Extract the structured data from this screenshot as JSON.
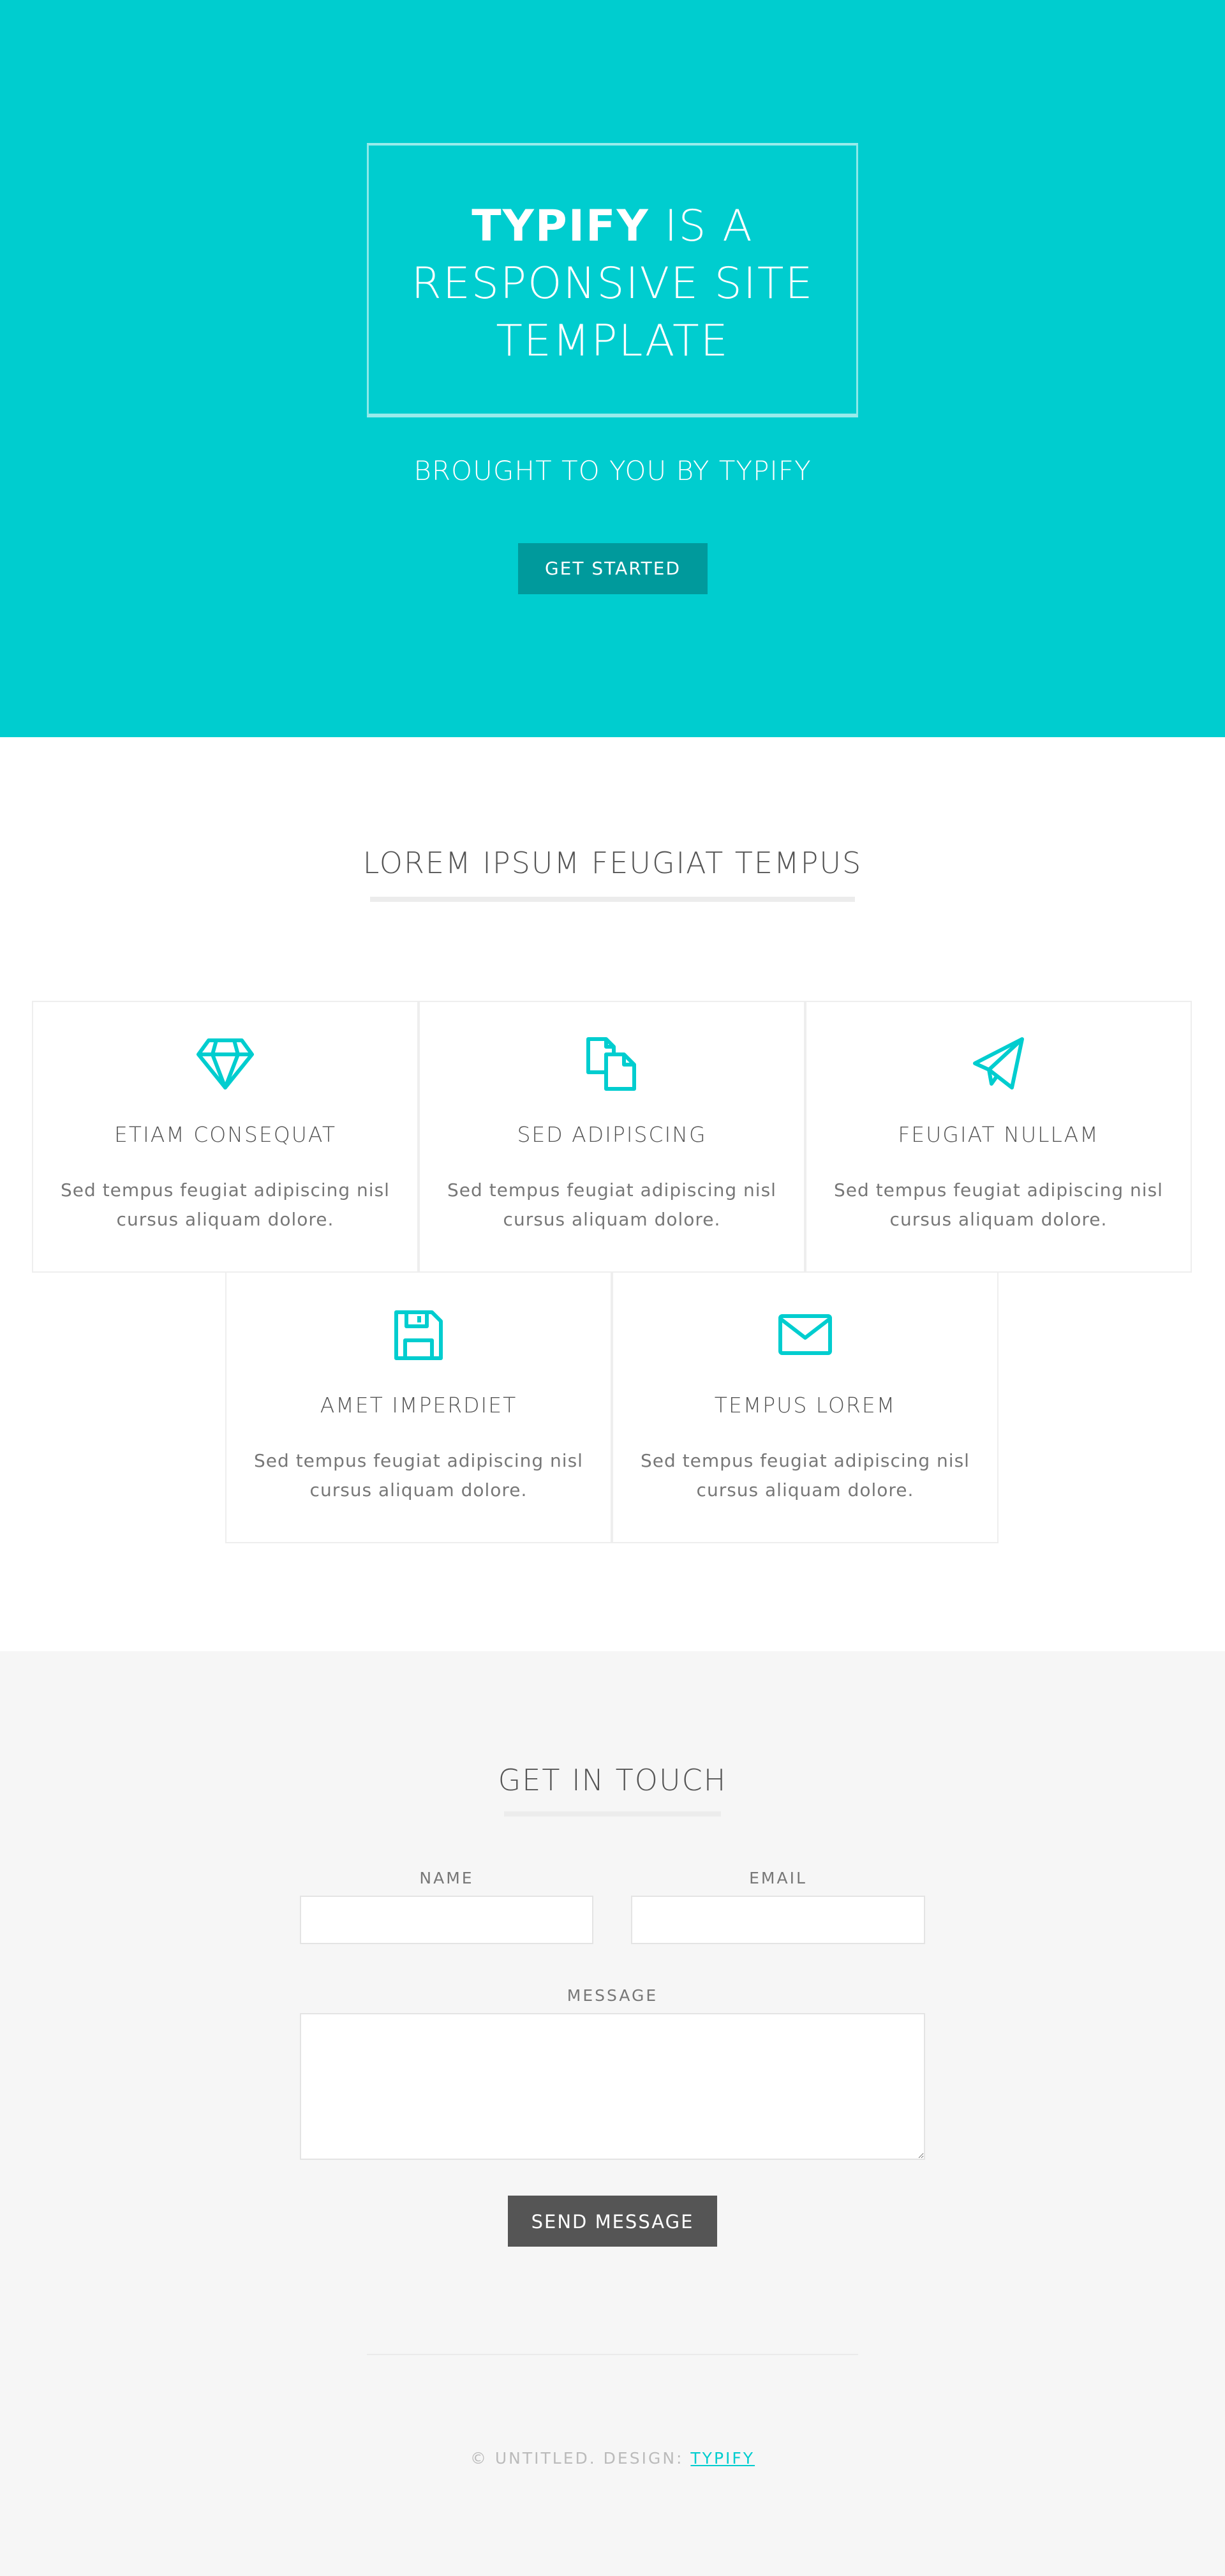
{
  "hero": {
    "title_strong": "TYPIFY",
    "title_line1_rest": " IS A",
    "title_line2": "RESPONSIVE SITE",
    "title_line3": "TEMPLATE",
    "subtitle": "BROUGHT TO YOU BY TYPIFY",
    "cta_label": "GET STARTED"
  },
  "features": {
    "heading": "LOREM IPSUM FEUGIAT TEMPUS",
    "items": [
      {
        "icon": "diamond-icon",
        "title": "ETIAM CONSEQUAT",
        "text": "Sed tempus feugiat adipiscing nisl cursus aliquam dolore."
      },
      {
        "icon": "documents-icon",
        "title": "SED ADIPISCING",
        "text": "Sed tempus feugiat adipiscing nisl cursus aliquam dolore."
      },
      {
        "icon": "paper-plane-icon",
        "title": "FEUGIAT NULLAM",
        "text": "Sed tempus feugiat adipiscing nisl cursus aliquam dolore."
      },
      {
        "icon": "floppy-disk-icon",
        "title": "AMET IMPERDIET",
        "text": "Sed tempus feugiat adipiscing nisl cursus aliquam dolore."
      },
      {
        "icon": "envelope-icon",
        "title": "TEMPUS LOREM",
        "text": "Sed tempus feugiat adipiscing nisl cursus aliquam dolore."
      }
    ]
  },
  "contact": {
    "heading": "GET IN TOUCH",
    "name_label": "NAME",
    "name_value": "",
    "email_label": "EMAIL",
    "email_value": "",
    "message_label": "MESSAGE",
    "message_value": "",
    "send_label": "SEND MESSAGE"
  },
  "footer": {
    "copyright": "© UNTITLED. DESIGN: ",
    "design_link": "TYPIFY"
  },
  "colors": {
    "accent": "#00cdcf",
    "accent_dark": "#009a9c",
    "button_dark": "#555555"
  }
}
